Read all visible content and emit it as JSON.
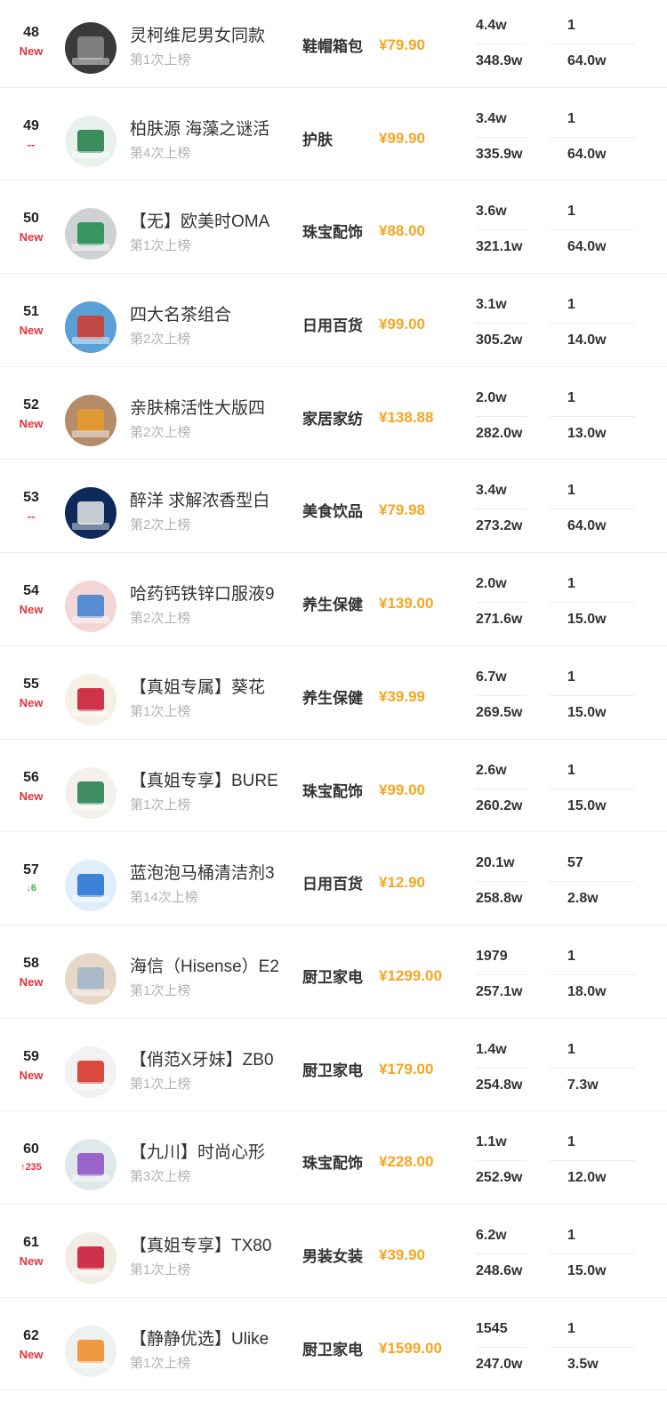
{
  "rows": [
    {
      "rank": "48",
      "change": "New",
      "change_type": "new",
      "title": "灵柯维尼男女同款",
      "times": "第1次上榜",
      "category": "鞋帽箱包",
      "price": "¥79.90",
      "s1": "4.4w",
      "s2": "348.9w",
      "s3": "1",
      "s4": "64.0w",
      "thumb_icon": "sneaker-image",
      "thumb_bg": "#3a3a3a",
      "thumb_fg": "#8a8a8a"
    },
    {
      "rank": "49",
      "change": "--",
      "change_type": "same",
      "title": "柏肤源 海藻之谜活",
      "times": "第4次上榜",
      "category": "护肤",
      "price": "¥99.90",
      "s1": "3.4w",
      "s2": "335.9w",
      "s3": "1",
      "s4": "64.0w",
      "thumb_icon": "skincare-box-image",
      "thumb_bg": "#e9f1ec",
      "thumb_fg": "#1e7a45"
    },
    {
      "rank": "50",
      "change": "New",
      "change_type": "new",
      "title": "【无】欧美时OMA",
      "times": "第1次上榜",
      "category": "珠宝配饰",
      "price": "¥88.00",
      "s1": "3.6w",
      "s2": "321.1w",
      "s3": "1",
      "s4": "64.0w",
      "thumb_icon": "watch-image",
      "thumb_bg": "#cfd2d4",
      "thumb_fg": "#1f8a4c"
    },
    {
      "rank": "51",
      "change": "New",
      "change_type": "new",
      "title": "四大名茶组合",
      "times": "第2次上榜",
      "category": "日用百货",
      "price": "¥99.00",
      "s1": "3.1w",
      "s2": "305.2w",
      "s3": "1",
      "s4": "14.0w",
      "thumb_icon": "tea-cans-image",
      "thumb_bg": "#5aa0d6",
      "thumb_fg": "#d33a2c"
    },
    {
      "rank": "52",
      "change": "New",
      "change_type": "new",
      "title": "亲肤棉活性大版四",
      "times": "第2次上榜",
      "category": "家居家纺",
      "price": "¥138.88",
      "s1": "2.0w",
      "s2": "282.0w",
      "s3": "1",
      "s4": "13.0w",
      "thumb_icon": "bedding-image",
      "thumb_bg": "#b58c6a",
      "thumb_fg": "#e89a2c"
    },
    {
      "rank": "53",
      "change": "--",
      "change_type": "same",
      "title": "醉洋 求解浓香型白",
      "times": "第2次上榜",
      "category": "美食饮品",
      "price": "¥79.98",
      "s1": "3.4w",
      "s2": "273.2w",
      "s3": "1",
      "s4": "64.0w",
      "thumb_icon": "liquor-box-image",
      "thumb_bg": "#0e2a5a",
      "thumb_fg": "#e6e6e6"
    },
    {
      "rank": "54",
      "change": "New",
      "change_type": "new",
      "title": "哈药钙铁锌口服液9",
      "times": "第2次上榜",
      "category": "养生保健",
      "price": "¥139.00",
      "s1": "2.0w",
      "s2": "271.6w",
      "s3": "1",
      "s4": "15.0w",
      "thumb_icon": "supplement-box-image",
      "thumb_bg": "#f3d7d7",
      "thumb_fg": "#3a7fd0"
    },
    {
      "rank": "55",
      "change": "New",
      "change_type": "new",
      "title": "【真姐专属】葵花",
      "times": "第1次上榜",
      "category": "养生保健",
      "price": "¥39.99",
      "s1": "6.7w",
      "s2": "269.5w",
      "s3": "1",
      "s4": "15.0w",
      "thumb_icon": "product-promo-image",
      "thumb_bg": "#f6efe4",
      "thumb_fg": "#c8102e"
    },
    {
      "rank": "56",
      "change": "New",
      "change_type": "new",
      "title": "【真姐专享】BURE",
      "times": "第1次上榜",
      "category": "珠宝配饰",
      "price": "¥99.00",
      "s1": "2.6w",
      "s2": "260.2w",
      "s3": "1",
      "s4": "15.0w",
      "thumb_icon": "watch-promo-image",
      "thumb_bg": "#f4f1ec",
      "thumb_fg": "#1f7a4c"
    },
    {
      "rank": "57",
      "change": "↓6",
      "change_type": "down",
      "title": "蓝泡泡马桶清洁剂3",
      "times": "第14次上榜",
      "category": "日用百货",
      "price": "¥12.90",
      "s1": "20.1w",
      "s2": "258.8w",
      "s3": "57",
      "s4": "2.8w",
      "thumb_icon": "cleaner-blocks-image",
      "thumb_bg": "#dfeefa",
      "thumb_fg": "#1f6fd1"
    },
    {
      "rank": "58",
      "change": "New",
      "change_type": "new",
      "title": "海信（Hisense）E2",
      "times": "第1次上榜",
      "category": "厨卫家电",
      "price": "¥1299.00",
      "s1": "1979",
      "s2": "257.1w",
      "s3": "1",
      "s4": "18.0w",
      "thumb_icon": "tv-image",
      "thumb_bg": "#e6d7c7",
      "thumb_fg": "#9fb5c9"
    },
    {
      "rank": "59",
      "change": "New",
      "change_type": "new",
      "title": "【俏范X牙妹】ZB0",
      "times": "第1次上榜",
      "category": "厨卫家电",
      "price": "¥179.00",
      "s1": "1.4w",
      "s2": "254.8w",
      "s3": "1",
      "s4": "7.3w",
      "thumb_icon": "appliance-promo-image",
      "thumb_bg": "#f2f2f2",
      "thumb_fg": "#d52b1e"
    },
    {
      "rank": "60",
      "change": "↑235",
      "change_type": "up",
      "title": "【九川】时尚心形",
      "times": "第3次上榜",
      "category": "珠宝配饰",
      "price": "¥228.00",
      "s1": "1.1w",
      "s2": "252.9w",
      "s3": "1",
      "s4": "12.0w",
      "thumb_icon": "heart-necklace-image",
      "thumb_bg": "#dfe9ec",
      "thumb_fg": "#8e4dc4"
    },
    {
      "rank": "61",
      "change": "New",
      "change_type": "new",
      "title": "【真姐专享】TX80",
      "times": "第1次上榜",
      "category": "男装女装",
      "price": "¥39.90",
      "s1": "6.2w",
      "s2": "248.6w",
      "s3": "1",
      "s4": "15.0w",
      "thumb_icon": "apparel-promo-image",
      "thumb_bg": "#f1ece4",
      "thumb_fg": "#c8102e"
    },
    {
      "rank": "62",
      "change": "New",
      "change_type": "new",
      "title": "【静静优选】Ulike",
      "times": "第1次上榜",
      "category": "厨卫家电",
      "price": "¥1599.00",
      "s1": "1545",
      "s2": "247.0w",
      "s3": "1",
      "s4": "3.5w",
      "thumb_icon": "beauty-device-image",
      "thumb_bg": "#eef2ef",
      "thumb_fg": "#f08a24"
    }
  ]
}
